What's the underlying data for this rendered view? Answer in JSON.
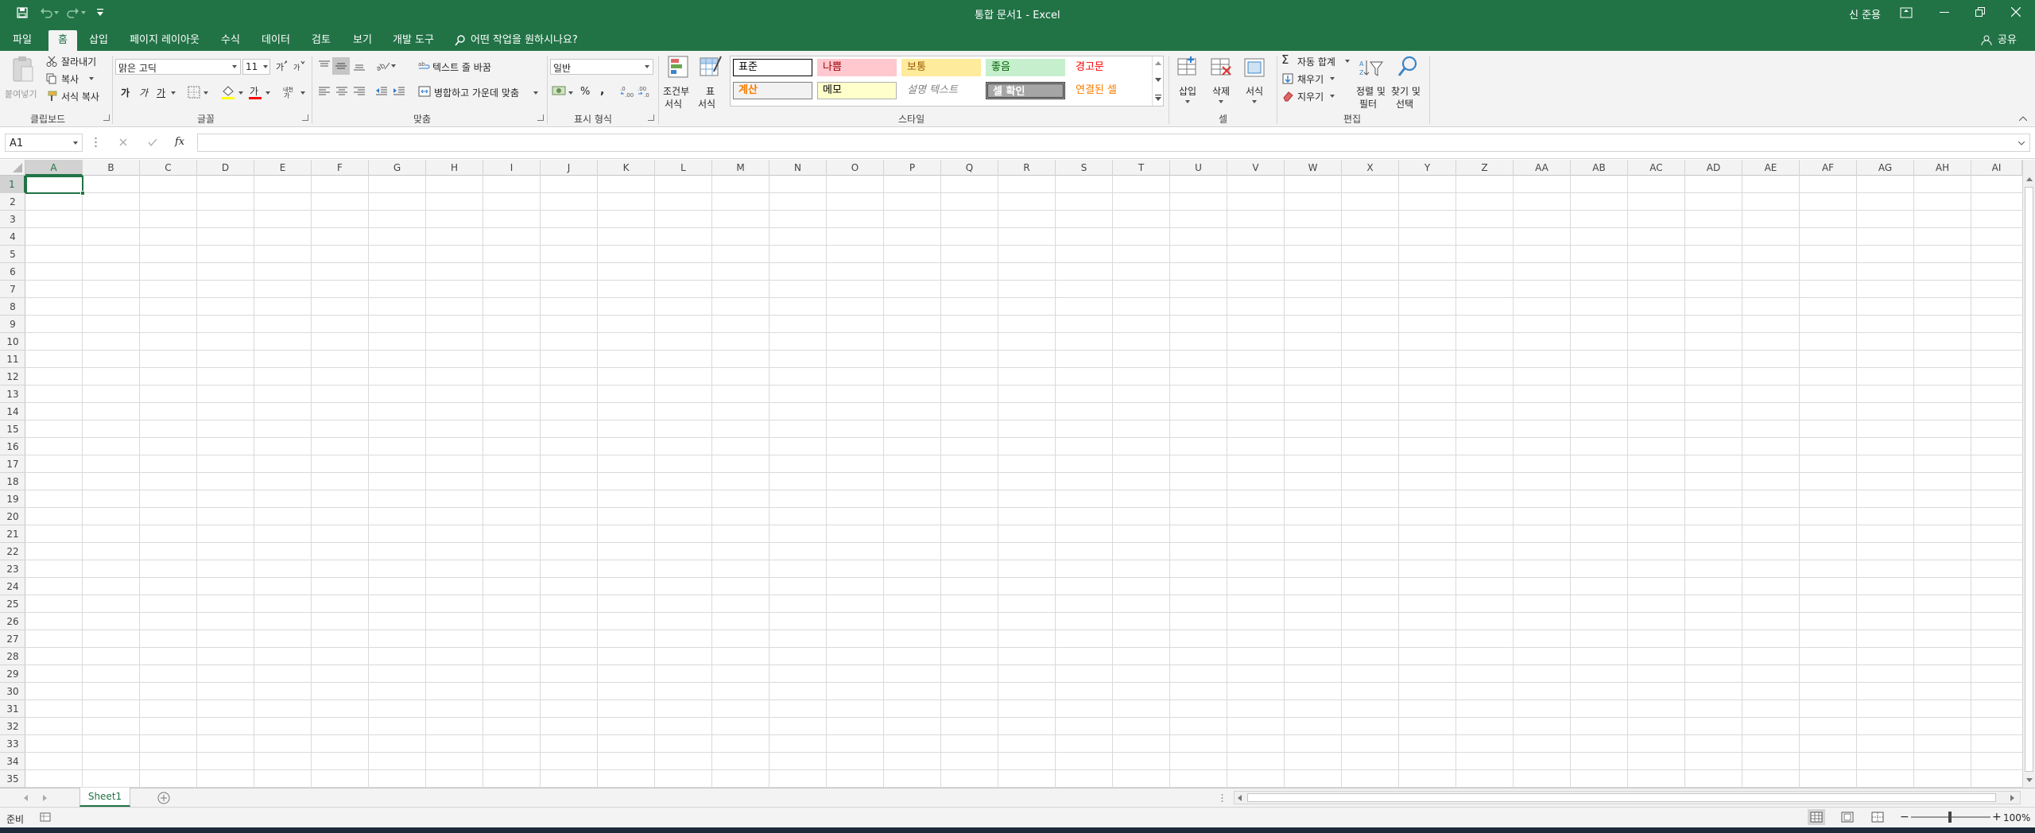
{
  "window": {
    "title": "통합 문서1  -  Excel",
    "user": "신 준용",
    "share_label": "공유"
  },
  "colors": {
    "brand": "#217346",
    "selection": "#217346"
  },
  "tabs": [
    "파일",
    "홈",
    "삽입",
    "페이지 레이아웃",
    "수식",
    "데이터",
    "검토",
    "보기",
    "개발 도구"
  ],
  "active_tab": "홈",
  "tell_me": "어떤 작업을 원하시나요?",
  "ribbon": {
    "clipboard": {
      "paste": "붙여넣기",
      "cut": "잘라내기",
      "copy": "복사",
      "format_painter": "서식 복사",
      "label": "클립보드"
    },
    "font": {
      "name": "맑은 고딕",
      "size": "11",
      "bold": "가",
      "italic": "가",
      "underline": "가",
      "phonetic": "내천",
      "label": "글꼴"
    },
    "alignment": {
      "wrap": "텍스트 줄 바꿈",
      "merge": "병합하고 가운데 맞춤",
      "label": "맞춤"
    },
    "number": {
      "format": "일반",
      "percent": "%",
      "comma": ",",
      "label": "표시 형식"
    },
    "styles": {
      "conditional_1": "조건부",
      "conditional_2": "서식",
      "table_1": "표",
      "table_2": "서식",
      "cells": [
        {
          "label": "표준",
          "bg": "#ffffff",
          "color": "#000000",
          "border": "#000000"
        },
        {
          "label": "나쁨",
          "bg": "#ffc7ce",
          "color": "#9c0006",
          "border": "#ffc7ce"
        },
        {
          "label": "보통",
          "bg": "#ffeb9c",
          "color": "#9c5700",
          "border": "#ffeb9c"
        },
        {
          "label": "좋음",
          "bg": "#c6efce",
          "color": "#006100",
          "border": "#c6efce"
        },
        {
          "label": "경고문",
          "bg": "#ffffff",
          "color": "#ff0000",
          "border": "#ffffff"
        },
        {
          "label": "계산",
          "bg": "#f2f2f2",
          "color": "#fa7d00",
          "border": "#7f7f7f"
        },
        {
          "label": "메모",
          "bg": "#ffffcc",
          "color": "#000000",
          "border": "#b2b2b2"
        },
        {
          "label": "설명 텍스트",
          "bg": "#ffffff",
          "color": "#7f7f7f",
          "border": "#ffffff"
        },
        {
          "label": "셀 확인",
          "bg": "#a5a5a5",
          "color": "#ffffff",
          "border": "#3f3f3f"
        },
        {
          "label": "연결된 셀",
          "bg": "#ffffff",
          "color": "#fa7d00",
          "border": "#ffffff"
        }
      ],
      "label": "스타일"
    },
    "cells_group": {
      "insert": "삽입",
      "delete": "삭제",
      "format": "서식",
      "label": "셀"
    },
    "editing": {
      "autosum": "자동 합계",
      "fill": "채우기",
      "clear": "지우기",
      "sort_1": "정렬 및",
      "sort_2": "필터",
      "find_1": "찾기 및",
      "find_2": "선택",
      "label": "편집"
    }
  },
  "formula_bar": {
    "name_box": "A1",
    "fx": "fx",
    "value": ""
  },
  "columns": [
    "A",
    "B",
    "C",
    "D",
    "E",
    "F",
    "G",
    "H",
    "I",
    "J",
    "K",
    "L",
    "M",
    "N",
    "O",
    "P",
    "Q",
    "R",
    "S",
    "T",
    "U",
    "V",
    "W",
    "X",
    "Y",
    "Z",
    "AA",
    "AB",
    "AC",
    "AD",
    "AE",
    "AF",
    "AG",
    "AH",
    "AI"
  ],
  "rows": [
    "1",
    "2",
    "3",
    "4",
    "5",
    "6",
    "7",
    "8",
    "9",
    "10",
    "11",
    "12",
    "13",
    "14",
    "15",
    "16",
    "17",
    "18",
    "19",
    "20",
    "21",
    "22",
    "23",
    "24",
    "25",
    "26",
    "27",
    "28",
    "29",
    "30",
    "31",
    "32",
    "33",
    "34",
    "35"
  ],
  "sheet": {
    "tab": "Sheet1"
  },
  "status": {
    "ready": "준비",
    "zoom": "100%"
  }
}
